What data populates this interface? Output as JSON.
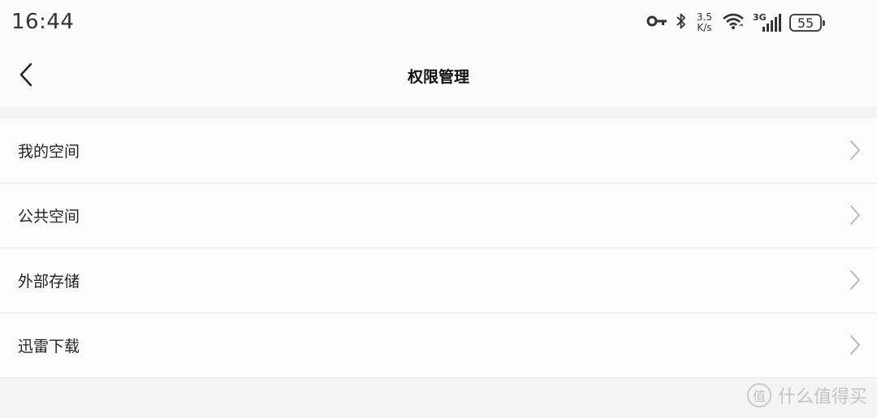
{
  "status_bar": {
    "time": "16:44",
    "net_speed_value": "3.5",
    "net_speed_unit": "K/s",
    "network_type": "3G",
    "battery": "55",
    "icons": [
      "key-icon",
      "bluetooth-icon",
      "wifi-icon",
      "signal-icon",
      "battery-icon"
    ]
  },
  "header": {
    "title": "权限管理",
    "back_icon": "chevron-left-icon"
  },
  "list": {
    "items": [
      {
        "label": "我的空间"
      },
      {
        "label": "公共空间"
      },
      {
        "label": "外部存储"
      },
      {
        "label": "迅雷下载"
      }
    ]
  },
  "watermark": {
    "badge": "值",
    "text": "什么值得买"
  },
  "colors": {
    "background": "#f4f4f4",
    "surface": "#fcfcfc",
    "divider": "#e6e6e6",
    "chevron": "#b5b5b5"
  }
}
